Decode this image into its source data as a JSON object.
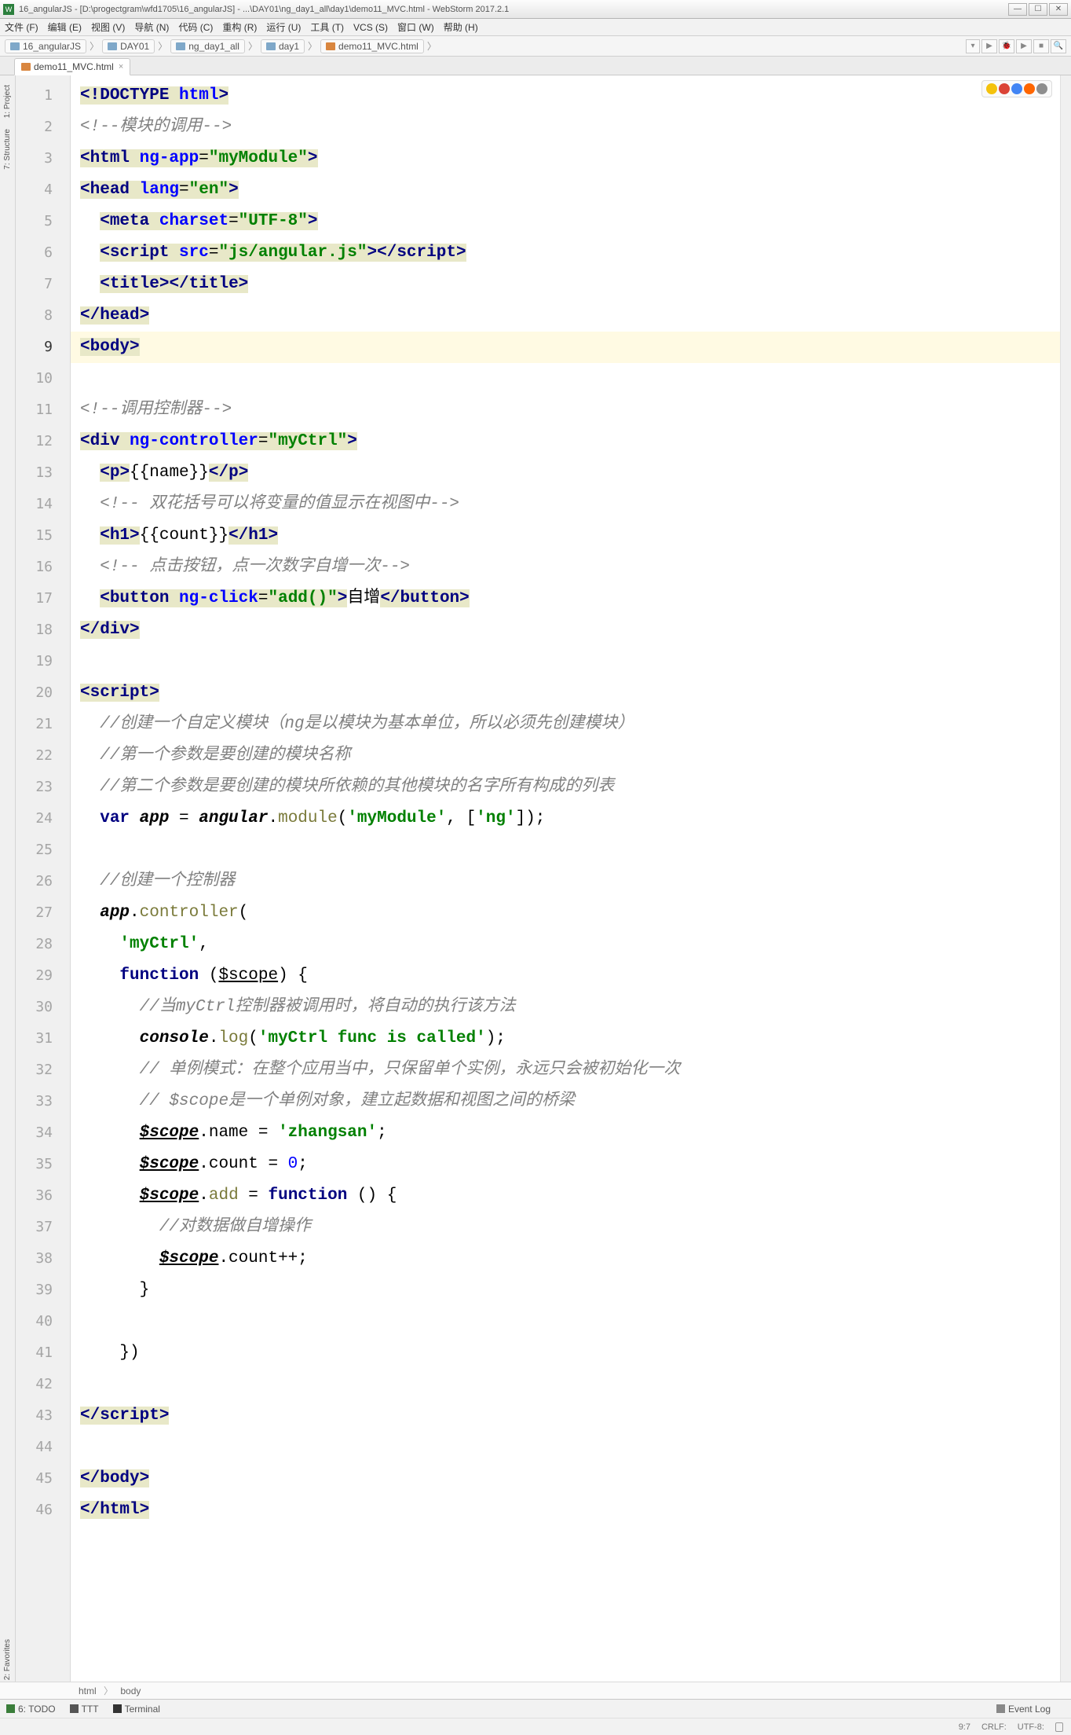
{
  "title": "16_angularJS - [D:\\progectgram\\wfd1705\\16_angularJS] - ...\\DAY01\\ng_day1_all\\day1\\demo11_MVC.html - WebStorm 2017.2.1",
  "menu": [
    "文件 (F)",
    "编辑 (E)",
    "视图 (V)",
    "导航 (N)",
    "代码 (C)",
    "重构 (R)",
    "运行 (U)",
    "工具 (T)",
    "VCS (S)",
    "窗口 (W)",
    "帮助 (H)"
  ],
  "breadcrumbs": [
    "16_angularJS",
    "DAY01",
    "ng_day1_all",
    "day1",
    "demo11_MVC.html"
  ],
  "tab": {
    "name": "demo11_MVC.html"
  },
  "left_tools": [
    "1: Project",
    "7: Structure"
  ],
  "left_tools_bottom": "2: Favorites",
  "editor_crumb": [
    "html",
    "body"
  ],
  "bottom": {
    "todo": "6: TODO",
    "ttt": "TTT",
    "terminal": "Terminal",
    "event_log": "Event Log"
  },
  "status": {
    "pos": "9:7",
    "le": "CRLF:",
    "enc": "UTF-8:"
  },
  "lines": [
    {
      "n": 1,
      "seg": [
        {
          "t": "<!",
          "c": "c-tag c-hlbg"
        },
        {
          "t": "DOCTYPE ",
          "c": "c-tag c-hlbg"
        },
        {
          "t": "html",
          "c": "c-attr c-hlbg"
        },
        {
          "t": ">",
          "c": "c-tag c-hlbg"
        }
      ]
    },
    {
      "n": 2,
      "seg": [
        {
          "t": "<!--模块的调用-->",
          "c": "c-cmt"
        }
      ]
    },
    {
      "n": 3,
      "seg": [
        {
          "t": "<",
          "c": "c-tag c-hlbg"
        },
        {
          "t": "html ",
          "c": "c-tag c-hlbg"
        },
        {
          "t": "ng-app",
          "c": "c-attr c-attr-bg"
        },
        {
          "t": "=",
          "c": "c-hlbg"
        },
        {
          "t": "\"myModule\"",
          "c": "c-str c-hlbg"
        },
        {
          "t": ">",
          "c": "c-tag c-hlbg"
        }
      ]
    },
    {
      "n": 4,
      "seg": [
        {
          "t": "<",
          "c": "c-tag c-hlbg"
        },
        {
          "t": "head ",
          "c": "c-tag c-hlbg"
        },
        {
          "t": "lang",
          "c": "c-attr c-hlbg"
        },
        {
          "t": "=",
          "c": "c-hlbg"
        },
        {
          "t": "\"en\"",
          "c": "c-str c-hlbg"
        },
        {
          "t": ">",
          "c": "c-tag c-hlbg"
        }
      ]
    },
    {
      "n": 5,
      "seg": [
        {
          "t": "  ",
          "c": ""
        },
        {
          "t": "<",
          "c": "c-tag c-hlbg"
        },
        {
          "t": "meta ",
          "c": "c-tag c-hlbg"
        },
        {
          "t": "charset",
          "c": "c-attr c-hlbg"
        },
        {
          "t": "=",
          "c": "c-hlbg"
        },
        {
          "t": "\"UTF-8\"",
          "c": "c-str c-hlbg"
        },
        {
          "t": ">",
          "c": "c-tag c-hlbg"
        }
      ]
    },
    {
      "n": 6,
      "seg": [
        {
          "t": "  ",
          "c": ""
        },
        {
          "t": "<",
          "c": "c-tag c-hlbg"
        },
        {
          "t": "script ",
          "c": "c-tag c-hlbg"
        },
        {
          "t": "src",
          "c": "c-attr c-hlbg"
        },
        {
          "t": "=",
          "c": "c-hlbg"
        },
        {
          "t": "\"js/angular.js\"",
          "c": "c-str c-hlbg"
        },
        {
          "t": "></",
          "c": "c-tag c-hlbg"
        },
        {
          "t": "script",
          "c": "c-tag c-hlbg"
        },
        {
          "t": ">",
          "c": "c-tag c-hlbg"
        }
      ]
    },
    {
      "n": 7,
      "seg": [
        {
          "t": "  ",
          "c": ""
        },
        {
          "t": "<",
          "c": "c-tag c-hlbg"
        },
        {
          "t": "title",
          "c": "c-tag c-hlbg"
        },
        {
          "t": "></",
          "c": "c-tag c-hlbg"
        },
        {
          "t": "title",
          "c": "c-tag c-hlbg"
        },
        {
          "t": ">",
          "c": "c-tag c-hlbg"
        }
      ]
    },
    {
      "n": 8,
      "seg": [
        {
          "t": "</",
          "c": "c-tag c-hlbg"
        },
        {
          "t": "head",
          "c": "c-tag c-hlbg"
        },
        {
          "t": ">",
          "c": "c-tag c-hlbg"
        }
      ]
    },
    {
      "n": 9,
      "cur": true,
      "seg": [
        {
          "t": "<",
          "c": "c-tag c-hlbg"
        },
        {
          "t": "body",
          "c": "c-tag c-hlbg"
        },
        {
          "t": ">",
          "c": "c-tag c-hlbg"
        }
      ]
    },
    {
      "n": 10,
      "seg": []
    },
    {
      "n": 11,
      "seg": [
        {
          "t": "<!--调用控制器-->",
          "c": "c-cmt"
        }
      ]
    },
    {
      "n": 12,
      "seg": [
        {
          "t": "<",
          "c": "c-tag c-hlbg"
        },
        {
          "t": "div ",
          "c": "c-tag c-hlbg"
        },
        {
          "t": "ng-controller",
          "c": "c-attr c-attr-bg"
        },
        {
          "t": "=",
          "c": "c-hlbg"
        },
        {
          "t": "\"myCtrl\"",
          "c": "c-str c-hlbg"
        },
        {
          "t": ">",
          "c": "c-tag c-hlbg"
        }
      ]
    },
    {
      "n": 13,
      "seg": [
        {
          "t": "  ",
          "c": ""
        },
        {
          "t": "<",
          "c": "c-tag c-hlbg"
        },
        {
          "t": "p",
          "c": "c-tag c-hlbg"
        },
        {
          "t": ">",
          "c": "c-tag c-hlbg"
        },
        {
          "t": "{{name}}",
          "c": "c-punc"
        },
        {
          "t": "</",
          "c": "c-tag c-hlbg"
        },
        {
          "t": "p",
          "c": "c-tag c-hlbg"
        },
        {
          "t": ">",
          "c": "c-tag c-hlbg"
        }
      ]
    },
    {
      "n": 14,
      "seg": [
        {
          "t": "  ",
          "c": ""
        },
        {
          "t": "<!-- 双花括号可以将变量的值显示在视图中-->",
          "c": "c-cmt"
        }
      ]
    },
    {
      "n": 15,
      "seg": [
        {
          "t": "  ",
          "c": ""
        },
        {
          "t": "<",
          "c": "c-tag c-hlbg"
        },
        {
          "t": "h1",
          "c": "c-tag c-hlbg"
        },
        {
          "t": ">",
          "c": "c-tag c-hlbg"
        },
        {
          "t": "{{count}}",
          "c": "c-punc"
        },
        {
          "t": "</",
          "c": "c-tag c-hlbg"
        },
        {
          "t": "h1",
          "c": "c-tag c-hlbg"
        },
        {
          "t": ">",
          "c": "c-tag c-hlbg"
        }
      ]
    },
    {
      "n": 16,
      "seg": [
        {
          "t": "  ",
          "c": ""
        },
        {
          "t": "<!-- 点击按钮，点一次数字自增一次-->",
          "c": "c-cmt"
        }
      ]
    },
    {
      "n": 17,
      "seg": [
        {
          "t": "  ",
          "c": ""
        },
        {
          "t": "<",
          "c": "c-tag c-hlbg"
        },
        {
          "t": "button ",
          "c": "c-tag c-hlbg"
        },
        {
          "t": "ng-click",
          "c": "c-attr c-attr-bg"
        },
        {
          "t": "=",
          "c": "c-hlbg"
        },
        {
          "t": "\"add()\"",
          "c": "c-str c-hlbg"
        },
        {
          "t": ">",
          "c": "c-tag c-hlbg"
        },
        {
          "t": "自增",
          "c": "c-punc"
        },
        {
          "t": "</",
          "c": "c-tag c-hlbg"
        },
        {
          "t": "button",
          "c": "c-tag c-hlbg"
        },
        {
          "t": ">",
          "c": "c-tag c-hlbg"
        }
      ]
    },
    {
      "n": 18,
      "seg": [
        {
          "t": "</",
          "c": "c-tag c-hlbg"
        },
        {
          "t": "div",
          "c": "c-tag c-hlbg"
        },
        {
          "t": ">",
          "c": "c-tag c-hlbg"
        }
      ]
    },
    {
      "n": 19,
      "seg": []
    },
    {
      "n": 20,
      "seg": [
        {
          "t": "<",
          "c": "c-tag c-hlbg"
        },
        {
          "t": "script",
          "c": "c-tag c-hlbg"
        },
        {
          "t": ">",
          "c": "c-tag c-hlbg"
        }
      ]
    },
    {
      "n": 21,
      "seg": [
        {
          "t": "  ",
          "c": ""
        },
        {
          "t": "//创建一个自定义模块（ng是以模块为基本单位，所以必须先创建模块）",
          "c": "c-cmt"
        }
      ]
    },
    {
      "n": 22,
      "seg": [
        {
          "t": "  ",
          "c": ""
        },
        {
          "t": "//第一个参数是要创建的模块名称",
          "c": "c-cmt"
        }
      ]
    },
    {
      "n": 23,
      "seg": [
        {
          "t": "  ",
          "c": ""
        },
        {
          "t": "//第二个参数是要创建的模块所依赖的其他模块的名字所有构成的列表",
          "c": "c-cmt"
        }
      ]
    },
    {
      "n": 24,
      "seg": [
        {
          "t": "  ",
          "c": ""
        },
        {
          "t": "var ",
          "c": "c-kw"
        },
        {
          "t": "app",
          "c": "c-it"
        },
        {
          "t": " = ",
          "c": "c-punc"
        },
        {
          "t": "angular",
          "c": "c-it"
        },
        {
          "t": ".",
          "c": "c-punc"
        },
        {
          "t": "module",
          "c": "c-fn"
        },
        {
          "t": "(",
          "c": "c-punc"
        },
        {
          "t": "'myModule'",
          "c": "c-str"
        },
        {
          "t": ", [",
          "c": "c-punc"
        },
        {
          "t": "'ng'",
          "c": "c-str"
        },
        {
          "t": "]);",
          "c": "c-punc"
        }
      ]
    },
    {
      "n": 25,
      "seg": []
    },
    {
      "n": 26,
      "seg": [
        {
          "t": "  ",
          "c": ""
        },
        {
          "t": "//创建一个控制器",
          "c": "c-cmt"
        }
      ]
    },
    {
      "n": 27,
      "seg": [
        {
          "t": "  ",
          "c": ""
        },
        {
          "t": "app",
          "c": "c-it"
        },
        {
          "t": ".",
          "c": "c-punc"
        },
        {
          "t": "controller",
          "c": "c-fn"
        },
        {
          "t": "(",
          "c": "c-punc"
        }
      ]
    },
    {
      "n": 28,
      "seg": [
        {
          "t": "    ",
          "c": ""
        },
        {
          "t": "'myCtrl'",
          "c": "c-str"
        },
        {
          "t": ",",
          "c": "c-punc"
        }
      ]
    },
    {
      "n": 29,
      "seg": [
        {
          "t": "    ",
          "c": ""
        },
        {
          "t": "function ",
          "c": "c-kw"
        },
        {
          "t": "(",
          "c": "c-punc"
        },
        {
          "t": "$scope",
          "c": "c-under"
        },
        {
          "t": ") {",
          "c": "c-punc"
        }
      ]
    },
    {
      "n": 30,
      "seg": [
        {
          "t": "      ",
          "c": ""
        },
        {
          "t": "//当myCtrl控制器被调用时，将自动的执行该方法",
          "c": "c-cmt"
        }
      ]
    },
    {
      "n": 31,
      "seg": [
        {
          "t": "      ",
          "c": ""
        },
        {
          "t": "console",
          "c": "c-it"
        },
        {
          "t": ".",
          "c": "c-punc"
        },
        {
          "t": "log",
          "c": "c-fn"
        },
        {
          "t": "(",
          "c": "c-punc"
        },
        {
          "t": "'myCtrl func is called'",
          "c": "c-str"
        },
        {
          "t": ");",
          "c": "c-punc"
        }
      ]
    },
    {
      "n": 32,
      "seg": [
        {
          "t": "      ",
          "c": ""
        },
        {
          "t": "// 单例模式：在整个应用当中，只保留单个实例，永远只会被初始化一次",
          "c": "c-cmt"
        }
      ]
    },
    {
      "n": 33,
      "seg": [
        {
          "t": "      ",
          "c": ""
        },
        {
          "t": "// $scope是一个单例对象，建立起数据和视图之间的桥梁",
          "c": "c-cmt"
        }
      ]
    },
    {
      "n": 34,
      "seg": [
        {
          "t": "      ",
          "c": ""
        },
        {
          "t": "$scope",
          "c": "c-under c-it"
        },
        {
          "t": ".name = ",
          "c": "c-punc"
        },
        {
          "t": "'zhangsan'",
          "c": "c-str"
        },
        {
          "t": ";",
          "c": "c-punc"
        }
      ]
    },
    {
      "n": 35,
      "seg": [
        {
          "t": "      ",
          "c": ""
        },
        {
          "t": "$scope",
          "c": "c-under c-it"
        },
        {
          "t": ".count = ",
          "c": "c-punc"
        },
        {
          "t": "0",
          "c": "c-num"
        },
        {
          "t": ";",
          "c": "c-punc"
        }
      ]
    },
    {
      "n": 36,
      "seg": [
        {
          "t": "      ",
          "c": ""
        },
        {
          "t": "$scope",
          "c": "c-under c-it"
        },
        {
          "t": ".",
          "c": "c-punc"
        },
        {
          "t": "add",
          "c": "c-fn"
        },
        {
          "t": " = ",
          "c": "c-punc"
        },
        {
          "t": "function ",
          "c": "c-kw"
        },
        {
          "t": "() {",
          "c": "c-punc"
        }
      ]
    },
    {
      "n": 37,
      "seg": [
        {
          "t": "        ",
          "c": ""
        },
        {
          "t": "//对数据做自增操作",
          "c": "c-cmt"
        }
      ]
    },
    {
      "n": 38,
      "seg": [
        {
          "t": "        ",
          "c": ""
        },
        {
          "t": "$scope",
          "c": "c-under c-it"
        },
        {
          "t": ".count++;",
          "c": "c-punc"
        }
      ]
    },
    {
      "n": 39,
      "seg": [
        {
          "t": "      }",
          "c": "c-punc"
        }
      ]
    },
    {
      "n": 40,
      "seg": []
    },
    {
      "n": 41,
      "seg": [
        {
          "t": "    })",
          "c": "c-punc"
        }
      ]
    },
    {
      "n": 42,
      "seg": []
    },
    {
      "n": 43,
      "seg": [
        {
          "t": "</",
          "c": "c-tag c-hlbg"
        },
        {
          "t": "script",
          "c": "c-tag c-hlbg"
        },
        {
          "t": ">",
          "c": "c-tag c-hlbg"
        }
      ]
    },
    {
      "n": 44,
      "seg": []
    },
    {
      "n": 45,
      "seg": [
        {
          "t": "</",
          "c": "c-tag c-hlbg"
        },
        {
          "t": "body",
          "c": "c-tag c-hlbg"
        },
        {
          "t": ">",
          "c": "c-tag c-hlbg"
        }
      ]
    },
    {
      "n": 46,
      "seg": [
        {
          "t": "</",
          "c": "c-tag c-hlbg"
        },
        {
          "t": "html",
          "c": "c-tag c-hlbg"
        },
        {
          "t": ">",
          "c": "c-tag c-hlbg"
        }
      ]
    }
  ],
  "browsers": [
    "#f4c20d",
    "#db4437",
    "#4285f4",
    "#ff6600",
    "#8e8e8e"
  ]
}
